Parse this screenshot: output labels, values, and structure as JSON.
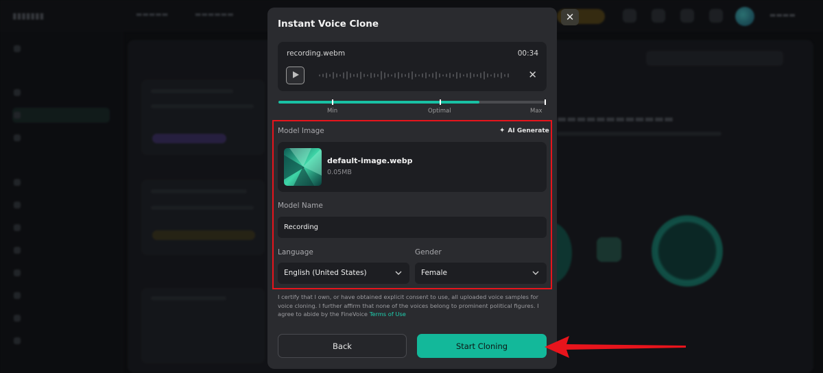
{
  "modal": {
    "title": "Instant Voice Clone",
    "close_icon": "close-icon"
  },
  "recording": {
    "file_name": "recording.webm",
    "duration": "00:34",
    "quality_labels": {
      "min": "Min",
      "optimal": "Optimal",
      "max": "Max"
    },
    "quality_fraction": 0.75
  },
  "model_image": {
    "label": "Model Image",
    "ai_generate_label": "AI Generate",
    "file_name": "default-image.webp",
    "file_size": "0.05MB"
  },
  "model_name": {
    "label": "Model Name",
    "value": "Recording"
  },
  "language": {
    "label": "Language",
    "value": "English (United States)"
  },
  "gender": {
    "label": "Gender",
    "value": "Female"
  },
  "disclaimer": {
    "text": "I certify that I own, or have obtained explicit consent to use, all uploaded voice samples for voice cloning. I further affirm that none of the voices belong to prominent political figures. I agree to abide by the FineVoice ",
    "terms_link": "Terms of Use"
  },
  "buttons": {
    "back": "Back",
    "start": "Start Cloning"
  },
  "colors": {
    "accent": "#13b89a",
    "highlight": "#e8141c",
    "modal_bg": "#2a2b2f"
  }
}
